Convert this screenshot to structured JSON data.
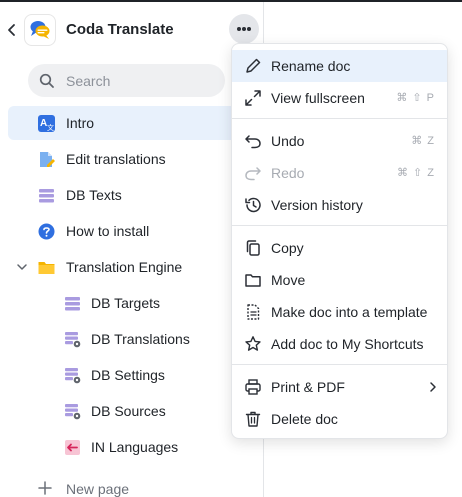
{
  "app": {
    "title": "Coda Translate"
  },
  "search": {
    "placeholder": "Search"
  },
  "pages": [
    {
      "label": "Intro",
      "icon": "translate-icon",
      "active": true
    },
    {
      "label": "Edit translations",
      "icon": "document-edit-icon"
    },
    {
      "label": "DB Texts",
      "icon": "table-icon"
    },
    {
      "label": "How to install",
      "icon": "question-icon"
    },
    {
      "label": "Translation Engine",
      "icon": "folder-icon",
      "expanded": true
    },
    {
      "label": "DB Targets",
      "icon": "table-icon"
    },
    {
      "label": "DB Translations",
      "icon": "table-gear-icon"
    },
    {
      "label": "DB Settings",
      "icon": "table-gear-icon"
    },
    {
      "label": "DB Sources",
      "icon": "table-gear-icon"
    },
    {
      "label": "IN Languages",
      "icon": "input-arrow-icon"
    }
  ],
  "new_page": {
    "label": "New page"
  },
  "menu": {
    "items": [
      {
        "label": "Rename doc",
        "icon": "pencil-icon",
        "highlighted": true
      },
      {
        "label": "View fullscreen",
        "icon": "expand-icon",
        "shortcut": "⌘ ⇧ P"
      },
      {
        "label": "Undo",
        "icon": "undo-icon",
        "shortcut": "⌘ Z"
      },
      {
        "label": "Redo",
        "icon": "redo-icon",
        "shortcut": "⌘ ⇧ Z",
        "disabled": true
      },
      {
        "label": "Version history",
        "icon": "history-icon"
      },
      {
        "label": "Copy",
        "icon": "copy-icon"
      },
      {
        "label": "Move",
        "icon": "folder-outline-icon"
      },
      {
        "label": "Make doc into a template",
        "icon": "template-icon"
      },
      {
        "label": "Add doc to My Shortcuts",
        "icon": "star-icon"
      },
      {
        "label": "Print & PDF",
        "icon": "printer-icon",
        "submenu": true
      },
      {
        "label": "Delete doc",
        "icon": "trash-icon"
      }
    ]
  },
  "colors": {
    "active_bg": "#e8f1fc",
    "accent_blue": "#2f6fe0",
    "table_purple": "#a99be0",
    "folder_yellow": "#f5b400",
    "pink": "#f0a8c0"
  }
}
